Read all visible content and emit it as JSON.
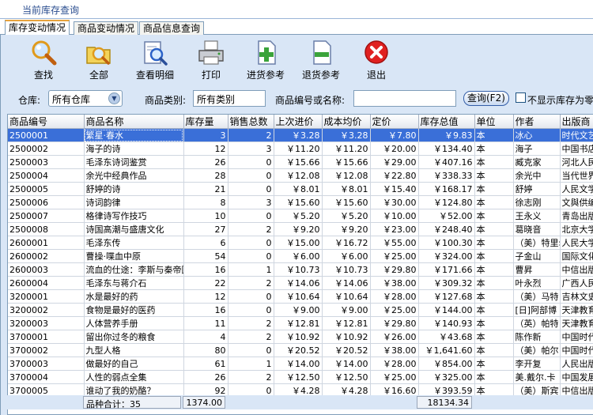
{
  "window": {
    "title": "当前库存查询"
  },
  "tabs": [
    {
      "label": "库存变动情况",
      "active": true
    },
    {
      "label": "商品变动情况",
      "active": false
    },
    {
      "label": "商品信息查询",
      "active": false
    }
  ],
  "toolbar": [
    {
      "label": "查找",
      "icon": "magnifier-icon"
    },
    {
      "label": "全部",
      "icon": "folder-magnifier-icon"
    },
    {
      "label": "查看明细",
      "icon": "document-magnifier-icon"
    },
    {
      "label": "打印",
      "icon": "printer-icon"
    },
    {
      "label": "进货参考",
      "icon": "document-plus-icon"
    },
    {
      "label": "退货参考",
      "icon": "document-minus-icon"
    },
    {
      "label": "退出",
      "icon": "close-icon"
    }
  ],
  "filters": {
    "warehouse_label": "仓库:",
    "warehouse_value": "所有仓库",
    "category_label": "商品类别:",
    "category_value": "所有类别",
    "code_label": "商品编号或名称:",
    "code_value": "",
    "query_button": "查询(F2)",
    "hide_zero_label": "不显示库存为零"
  },
  "colors": {
    "panel": "#d9e6f6",
    "selection": "#3a6fd8",
    "tab_accent": "#e8a33c"
  },
  "table": {
    "columns": [
      "商品编号",
      "商品名称",
      "库存量",
      "销售总数",
      "上次进价",
      "成本均价",
      "定价",
      "库存总值",
      "单位",
      "作者",
      "出版商"
    ],
    "rows": [
      [
        "2500001",
        "繁星·春水",
        "3",
        "2",
        "￥3.28",
        "￥3.28",
        "￥7.80",
        "￥9.83",
        "本",
        "冰心",
        "时代文艺"
      ],
      [
        "2500002",
        "海子的诗",
        "12",
        "3",
        "￥11.20",
        "￥11.20",
        "￥20.00",
        "￥134.40",
        "本",
        "海子",
        "中国书店"
      ],
      [
        "2500003",
        "毛泽东诗词鉴赏",
        "26",
        "0",
        "￥15.66",
        "￥15.66",
        "￥29.00",
        "￥407.16",
        "本",
        "臧克家",
        "河北人民"
      ],
      [
        "2500004",
        "余光中经典作品",
        "28",
        "0",
        "￥12.08",
        "￥12.08",
        "￥22.80",
        "￥338.33",
        "本",
        "余光中",
        "当代世界"
      ],
      [
        "2500005",
        "舒婷的诗",
        "21",
        "0",
        "￥8.01",
        "￥8.01",
        "￥15.40",
        "￥168.17",
        "本",
        "舒婷",
        "人民文学"
      ],
      [
        "2500006",
        "诗词韵律",
        "8",
        "3",
        "￥15.60",
        "￥15.60",
        "￥30.00",
        "￥124.80",
        "本",
        "徐志刚",
        "文與供编"
      ],
      [
        "2500007",
        "格律诗写作技巧",
        "10",
        "0",
        "￥5.20",
        "￥5.20",
        "￥10.00",
        "￥52.00",
        "本",
        "王永义",
        "青岛出版"
      ],
      [
        "2500008",
        "诗国高潮与盛唐文化",
        "27",
        "2",
        "￥9.20",
        "￥9.20",
        "￥23.00",
        "￥248.40",
        "本",
        "葛晓音",
        "北京大学"
      ],
      [
        "2600001",
        "毛泽东传",
        "6",
        "0",
        "￥15.00",
        "￥16.72",
        "￥55.00",
        "￥100.30",
        "本",
        "（美）特里尔",
        "人民大学"
      ],
      [
        "2600002",
        "曹操·喋血中原",
        "54",
        "0",
        "￥6.00",
        "￥6.00",
        "￥25.00",
        "￥324.00",
        "本",
        "子金山",
        "国际文化"
      ],
      [
        "2600003",
        "流血的仕途：李斯与秦帝国",
        "16",
        "1",
        "￥10.73",
        "￥10.73",
        "￥29.80",
        "￥171.66",
        "本",
        "曹昇",
        "中信出版"
      ],
      [
        "2600004",
        "毛泽东与蒋介石",
        "22",
        "2",
        "￥14.06",
        "￥14.06",
        "￥38.00",
        "￥309.32",
        "本",
        "叶永烈",
        "广西人民"
      ],
      [
        "3200001",
        "水是最好的药",
        "12",
        "0",
        "￥10.64",
        "￥10.64",
        "￥28.00",
        "￥127.68",
        "本",
        "（美）马特",
        "吉林文史"
      ],
      [
        "3200002",
        "食物是最好的医药",
        "16",
        "0",
        "￥9.00",
        "￥9.00",
        "￥25.00",
        "￥144.00",
        "本",
        "[日]阿部博",
        "天津教育"
      ],
      [
        "3200003",
        "人体营养手册",
        "11",
        "2",
        "￥12.81",
        "￥12.81",
        "￥29.80",
        "￥140.93",
        "本",
        "（英）帕特",
        "天津教育"
      ],
      [
        "3700001",
        "留出你过冬的粮食",
        "4",
        "2",
        "￥10.92",
        "￥10.92",
        "￥26.00",
        "￥43.68",
        "本",
        "陈作新",
        "中国时代"
      ],
      [
        "3700002",
        "九型人格",
        "80",
        "0",
        "￥20.52",
        "￥20.52",
        "￥38.00",
        "￥1,641.60",
        "本",
        "（美）帕尔",
        "中国时代"
      ],
      [
        "3700003",
        "做最好的自己",
        "61",
        "1",
        "￥14.00",
        "￥14.00",
        "￥28.00",
        "￥854.00",
        "本",
        "李开复",
        "人民出版"
      ],
      [
        "3700004",
        "人性的弱点全集",
        "26",
        "2",
        "￥12.50",
        "￥12.50",
        "￥25.00",
        "￥325.00",
        "本",
        "美.戴尔.卡",
        "中国发展"
      ],
      [
        "3700005",
        "谁动了我的奶酪？",
        "92",
        "0",
        "￥4.28",
        "￥4.28",
        "￥16.60",
        "￥393.59",
        "本",
        "（美）斯宾",
        "中信出版"
      ]
    ]
  },
  "summary": {
    "item_count_label": "品种合计：35",
    "total_qty": "1374.00",
    "total_value": "18134.34"
  }
}
